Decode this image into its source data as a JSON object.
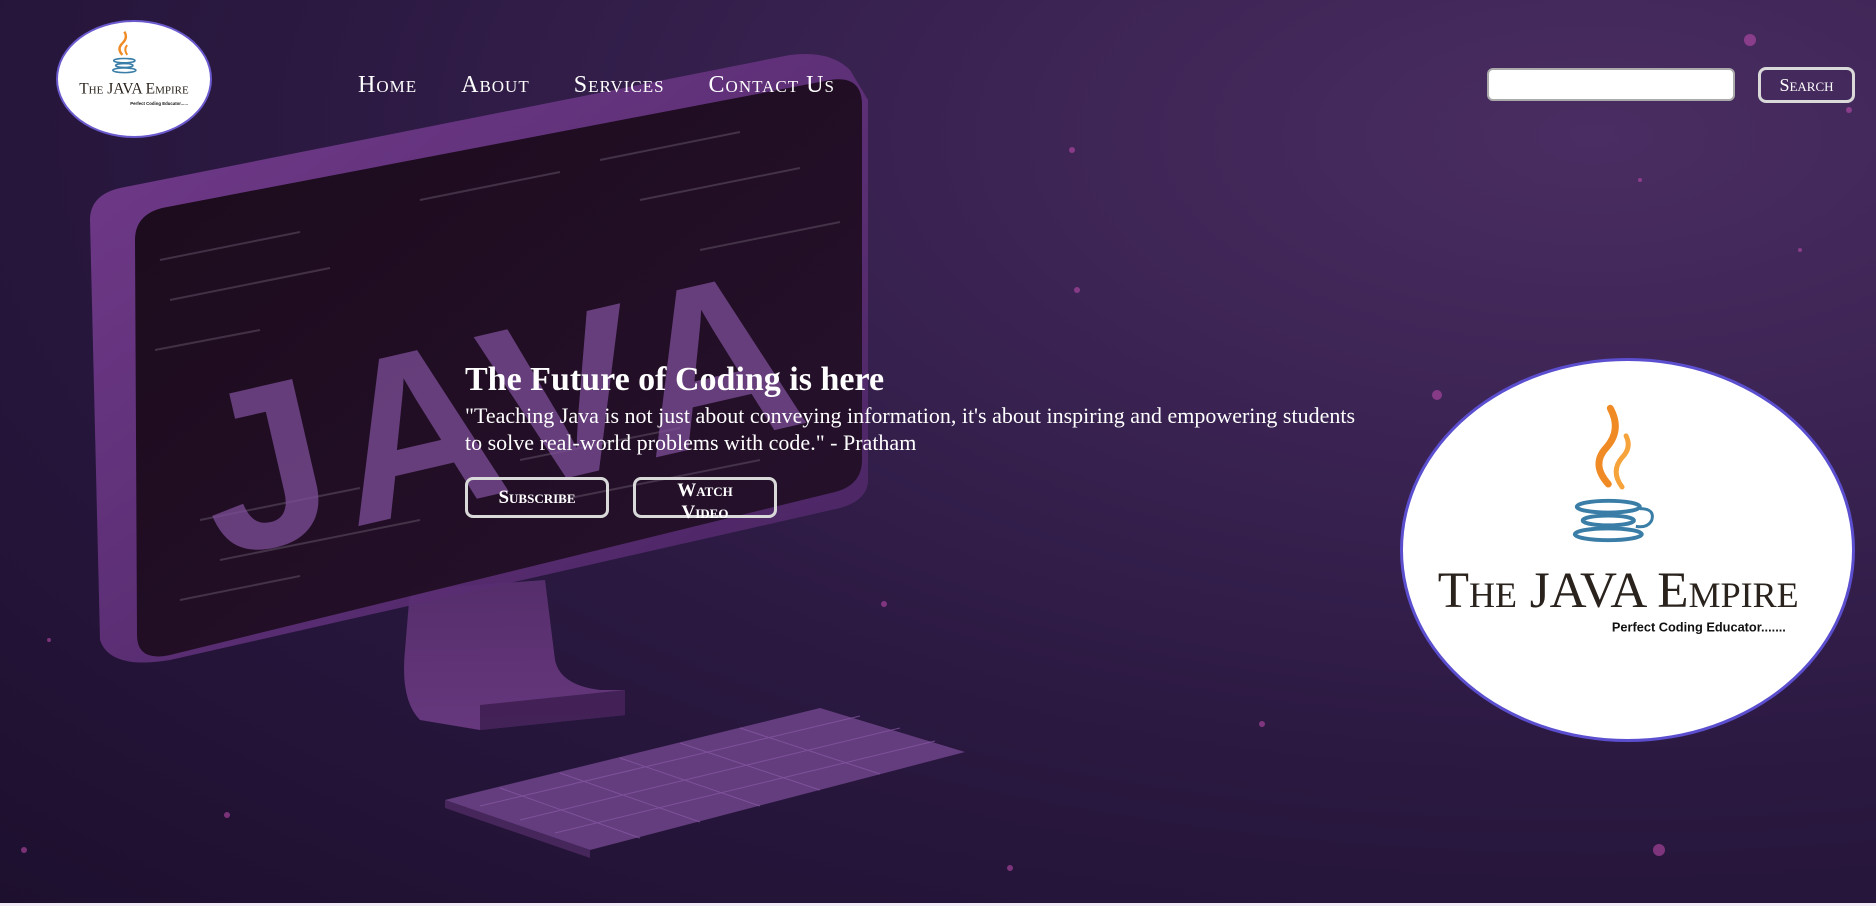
{
  "colors": {
    "background": "#2a1840",
    "accent": "#6a5acd",
    "text": "#ffffff",
    "button_border": "#d9d9d9"
  },
  "header": {
    "logo": {
      "title": "The JAVA Empire",
      "tagline": "Perfect Coding Educator......",
      "icon": "java-cup-icon"
    },
    "nav": [
      {
        "label": "Home"
      },
      {
        "label": "About"
      },
      {
        "label": "Services"
      },
      {
        "label": "Contact Us"
      }
    ],
    "search": {
      "value": "",
      "placeholder": "",
      "button_label": "Search"
    }
  },
  "hero": {
    "background_text": "JAVA",
    "title": "The Future of Coding is here",
    "quote": "\"Teaching Java is not just about conveying information, it's about inspiring and empowering students to solve real-world problems with code.\" - Pratham",
    "buttons": {
      "subscribe": "Subscribe",
      "watch_video": "Watch Video"
    }
  },
  "feature_logo": {
    "title": "The JAVA Empire",
    "tagline": "Perfect Coding Educator.......",
    "icon": "java-cup-icon"
  }
}
